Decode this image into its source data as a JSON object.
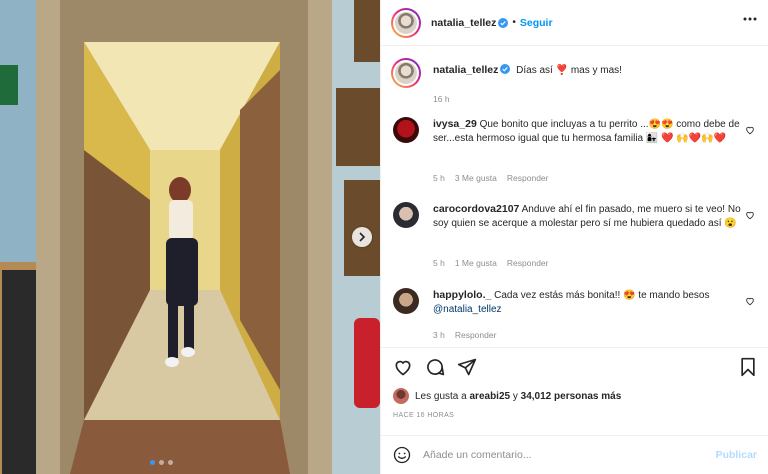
{
  "post": {
    "username": "natalia_tellez",
    "follow_label": "Seguir",
    "separator": "•",
    "more_icon": "more-horizontal-icon",
    "caption_user": "natalia_tellez",
    "caption_text": "Días así ❣️ mas y mas!",
    "caption_time": "16 h"
  },
  "comments": [
    {
      "user": "ivysa_29",
      "text": "Que bonito que incluyas a tu perrito ...😍😍 como debe de ser...esta hermoso igual que tu hermosa familia 👩‍👧 ❤️ 🙌❤️🙌❤️",
      "time": "5 h",
      "likes": "3 Me gusta",
      "reply": "Responder"
    },
    {
      "user": "carocordova2107",
      "text": "Anduve ahí el fin pasado, me muero si te veo! No soy quien se acerque a molestar pero sí me hubiera quedado así 😮",
      "time": "5 h",
      "likes": "1 Me gusta",
      "reply": "Responder"
    },
    {
      "user": "happylolo._",
      "text": "Cada vez estás más bonita!! 😍 te mando besos",
      "mention": "@natalia_tellez",
      "time": "3 h",
      "reply": "Responder"
    }
  ],
  "likes": {
    "prefix": "Les gusta a",
    "user": "areabi25",
    "middle": "y",
    "count": "34,012 personas más"
  },
  "timestamp": "HACE 16 HORAS",
  "composer": {
    "placeholder": "Añade un comentario...",
    "publish_label": "Publicar"
  },
  "colors": {
    "accent": "#0095f6",
    "publish_disabled": "#b3dbff",
    "secondary_text": "#8e8e8e"
  },
  "carousel": {
    "current": 1,
    "total": 3
  }
}
